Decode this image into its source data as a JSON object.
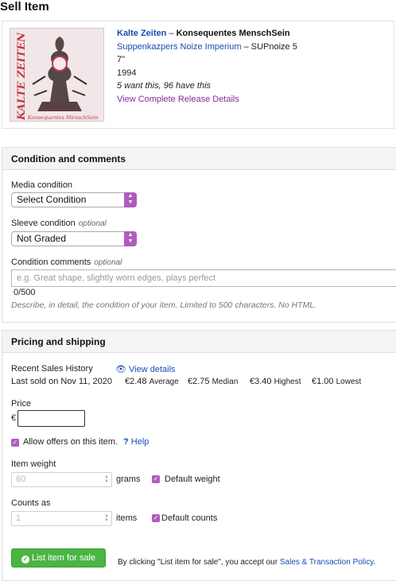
{
  "page": {
    "title": "Sell Item"
  },
  "release": {
    "artist": "Kalte Zeiten",
    "separator": " – ",
    "title": "Konsequentes MenschSein",
    "label": "Suppenkazpers Noize Imperium",
    "catno": " – SUPnoize 5",
    "format": "7\"",
    "year": "1994",
    "community": "5 want this, 96 have this",
    "details_link": "View Complete Release Details",
    "cover_text_top": "KALTE ZEITEN",
    "cover_text_bottom": "Konsequentes MenschSein"
  },
  "condition": {
    "heading": "Condition and comments",
    "media_label": "Media condition",
    "media_value": "Select Condition",
    "sleeve_label": "Sleeve condition",
    "sleeve_optional": "optional",
    "sleeve_value": "Not Graded",
    "comments_label": "Condition comments",
    "comments_optional": "optional",
    "comments_placeholder": "e.g. Great shape, slightly worn edges, plays perfect",
    "char_count": "0/500",
    "hint": "Describe, in detail, the condition of your item. Limited to 500 characters. No HTML."
  },
  "pricing": {
    "heading": "Pricing and shipping",
    "recent_sales_label": "Recent Sales History",
    "view_details": "View details",
    "last_sold": "Last sold on Nov 11, 2020",
    "average_value": "€2.48",
    "average_label": "Average",
    "median_value": "€2.75",
    "median_label": "Median",
    "highest_value": "€3.40",
    "highest_label": "Highest",
    "lowest_value": "€1.00",
    "lowest_label": "Lowest",
    "price_label": "Price",
    "currency": "€",
    "allow_offers": "Allow offers on this item.",
    "help": "Help",
    "weight_label": "Item weight",
    "weight_value": "60",
    "weight_unit": "grams",
    "default_weight": "Default weight",
    "counts_label": "Counts as",
    "counts_value": "1",
    "counts_unit": "items",
    "default_counts": "Default counts"
  },
  "footer": {
    "list_button": "List item for sale",
    "agreement": "By clicking \"List item for sale\", you accept our ",
    "policy_link": "Sales & Transaction Policy",
    "period": "."
  },
  "colors": {
    "accent": "#b15bbf",
    "link": "#1a4bb5",
    "button": "#4bb543"
  }
}
